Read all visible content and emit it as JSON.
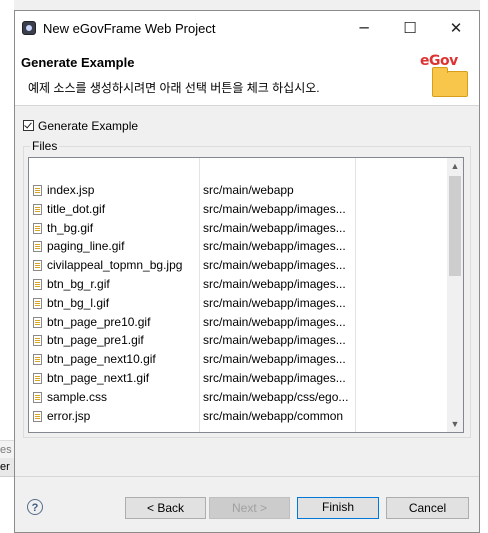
{
  "background": {
    "tab1": "es",
    "tab2": "er"
  },
  "window": {
    "title": "New eGovFrame Web Project",
    "minimize": "─",
    "maximize": "☐",
    "close": "✕"
  },
  "header": {
    "title": "Generate Example",
    "description": "예제 소스를 생성하시려면 아래 선택 버튼을 체크 하십시오.",
    "logo_text": "eGov"
  },
  "generate_example": {
    "label": "Generate Example",
    "checked": true
  },
  "files": {
    "group_label": "Files",
    "rows": [
      {
        "name": "index.jsp",
        "path": "src/main/webapp"
      },
      {
        "name": "title_dot.gif",
        "path": "src/main/webapp/images..."
      },
      {
        "name": "th_bg.gif",
        "path": "src/main/webapp/images..."
      },
      {
        "name": "paging_line.gif",
        "path": "src/main/webapp/images..."
      },
      {
        "name": "civilappeal_topmn_bg.jpg",
        "path": "src/main/webapp/images..."
      },
      {
        "name": "btn_bg_r.gif",
        "path": "src/main/webapp/images..."
      },
      {
        "name": "btn_bg_l.gif",
        "path": "src/main/webapp/images..."
      },
      {
        "name": "btn_page_pre10.gif",
        "path": "src/main/webapp/images..."
      },
      {
        "name": "btn_page_pre1.gif",
        "path": "src/main/webapp/images..."
      },
      {
        "name": "btn_page_next10.gif",
        "path": "src/main/webapp/images..."
      },
      {
        "name": "btn_page_next1.gif",
        "path": "src/main/webapp/images..."
      },
      {
        "name": "sample.css",
        "path": "src/main/webapp/css/ego..."
      },
      {
        "name": "error.jsp",
        "path": "src/main/webapp/common"
      }
    ]
  },
  "buttons": {
    "help": "?",
    "back": "< Back",
    "next": "Next >",
    "finish": "Finish",
    "cancel": "Cancel"
  }
}
